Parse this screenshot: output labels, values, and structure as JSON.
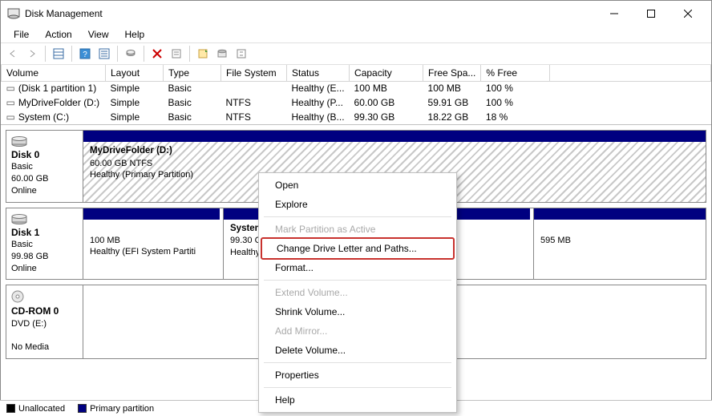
{
  "window": {
    "title": "Disk Management"
  },
  "menu": {
    "file": "File",
    "action": "Action",
    "view": "View",
    "help": "Help"
  },
  "volume_table": {
    "headers": {
      "volume": "Volume",
      "layout": "Layout",
      "type": "Type",
      "filesystem": "File System",
      "status": "Status",
      "capacity": "Capacity",
      "free": "Free Spa...",
      "pctfree": "% Free"
    },
    "rows": [
      {
        "volume": "(Disk 1 partition 1)",
        "layout": "Simple",
        "type": "Basic",
        "fs": "",
        "status": "Healthy (E...",
        "capacity": "100 MB",
        "free": "100 MB",
        "pct": "100 %"
      },
      {
        "volume": "MyDriveFolder (D:)",
        "layout": "Simple",
        "type": "Basic",
        "fs": "NTFS",
        "status": "Healthy (P...",
        "capacity": "60.00 GB",
        "free": "59.91 GB",
        "pct": "100 %"
      },
      {
        "volume": "System (C:)",
        "layout": "Simple",
        "type": "Basic",
        "fs": "NTFS",
        "status": "Healthy (B...",
        "capacity": "99.30 GB",
        "free": "18.22 GB",
        "pct": "18 %"
      }
    ]
  },
  "disks": {
    "d0": {
      "name": "Disk 0",
      "type": "Basic",
      "size": "60.00 GB",
      "state": "Online",
      "p0": {
        "title": "MyDriveFolder  (D:)",
        "sub": "60.00 GB NTFS",
        "status": "Healthy (Primary Partition)"
      }
    },
    "d1": {
      "name": "Disk 1",
      "type": "Basic",
      "size": "99.98 GB",
      "state": "Online",
      "p0": {
        "title": "",
        "sub": "100 MB",
        "status": "Healthy (EFI System Partiti"
      },
      "p1": {
        "title": "System",
        "sub": "99.30 G",
        "status": "Healthy"
      },
      "p2": {
        "title": "",
        "sub": "595 MB",
        "status": ""
      }
    },
    "cd0": {
      "name": "CD-ROM 0",
      "type": "DVD (E:)",
      "state": "No Media"
    }
  },
  "legend": {
    "unallocated": "Unallocated",
    "primary": "Primary partition"
  },
  "context_menu": {
    "open": "Open",
    "explore": "Explore",
    "mark_active": "Mark Partition as Active",
    "change_letter": "Change Drive Letter and Paths...",
    "format": "Format...",
    "extend": "Extend Volume...",
    "shrink": "Shrink Volume...",
    "add_mirror": "Add Mirror...",
    "delete": "Delete Volume...",
    "properties": "Properties",
    "help": "Help"
  }
}
